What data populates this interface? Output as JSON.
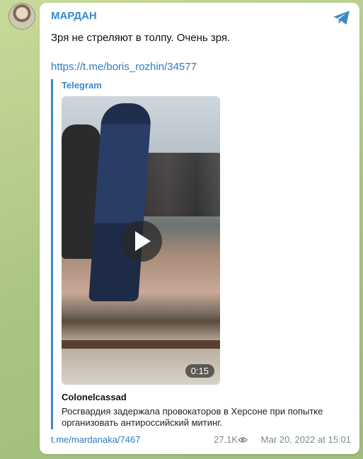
{
  "post": {
    "channel_name": "МАРДАН",
    "text": "Зря не стреляют в толпу. Очень зря.",
    "link": "https://t.me/boris_rozhin/34577"
  },
  "preview": {
    "site": "Telegram",
    "video_duration": "0:15",
    "title": "Colonelcassad",
    "description": "Росгвардия задержала провокаторов в Херсоне при попытке организовать антироссийский митинг."
  },
  "footer": {
    "post_link": "t.me/mardanaka/7467",
    "views": "27.1K",
    "date": "Mar 20, 2022 at 15:01"
  },
  "icons": {
    "telegram": "telegram-icon",
    "play": "play-icon",
    "views": "eye-icon"
  },
  "colors": {
    "accent": "#3a8ac9",
    "link": "#2c7cc3"
  }
}
